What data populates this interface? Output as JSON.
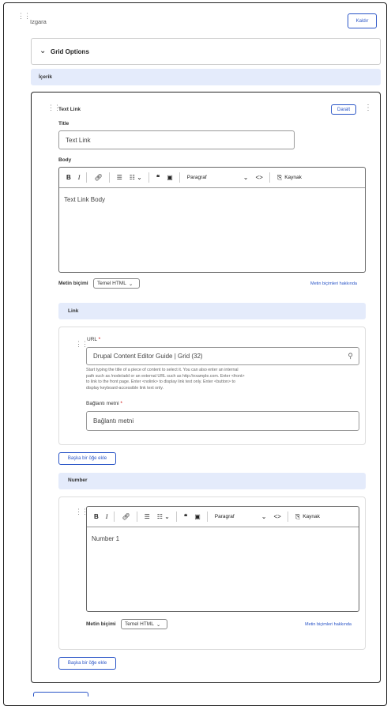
{
  "section": {
    "title": "Izgara",
    "remove_label": "Kaldır"
  },
  "grid_options": {
    "title": "Grid Options"
  },
  "content_bar": {
    "label": "İçerik"
  },
  "text_link": {
    "title": "Text Link",
    "collapse_label": "Daralt",
    "title_field": {
      "label": "Title",
      "value": "Text Link"
    },
    "body_field": {
      "label": "Body",
      "value": "Text Link Body"
    },
    "format": {
      "label": "Metin biçimi",
      "value": "Temel HTML",
      "about_link": "Metin biçimleri hakkında"
    },
    "link_section": {
      "label": "Link"
    },
    "url_field": {
      "label": "URL",
      "required": "*",
      "value": "Drupal Content Editor Guide | Grid (32)",
      "help": [
        "Start typing the title of a piece of content to select it. You can also enter an internal",
        "path such as /node/add or an external URL such as http://example.com. Enter <front>",
        "to link to the front page. Enter <nolink> to display link text only. Enter <button> to",
        "display keyboard-accessible link text only."
      ]
    },
    "link_text_field": {
      "label": "Bağlantı metni",
      "required": "*",
      "placeholder": "Bağlantı metni"
    },
    "add_another_1": "Başka bir öğe ekle",
    "number_section": {
      "label": "Number"
    },
    "number_body": "Number 1",
    "format2": {
      "label": "Metin biçimi",
      "value": "Temel HTML",
      "about_link": "Metin biçimleri hakkında"
    },
    "add_another_2": "Başka bir öğe ekle"
  },
  "toolbar": {
    "paragraph": "Paragraf",
    "source": "Kaynak"
  }
}
